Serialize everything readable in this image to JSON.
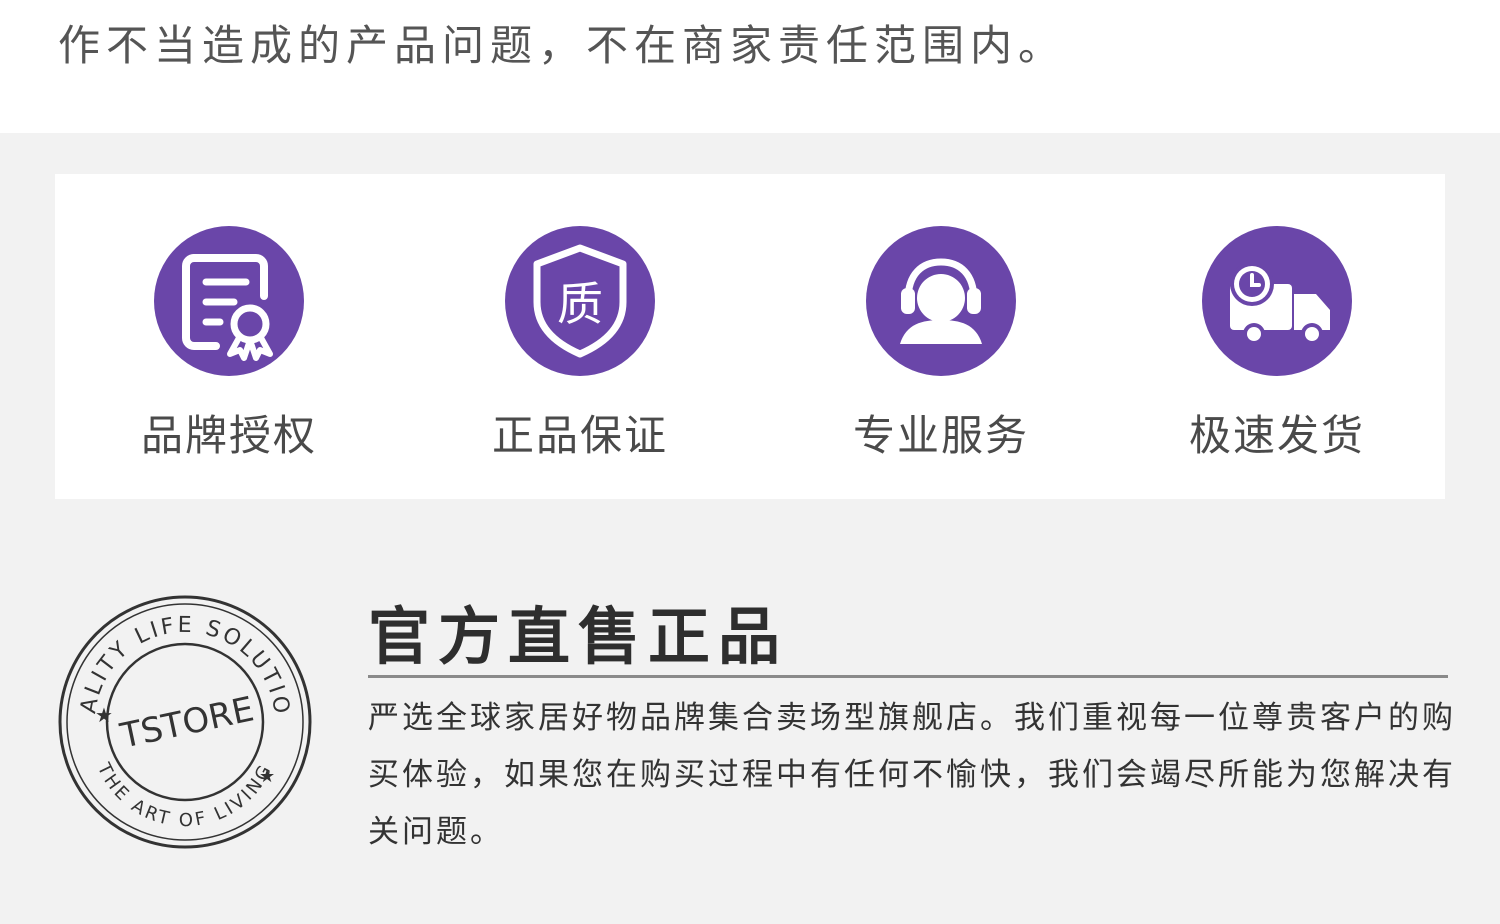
{
  "top_text": "作不当造成的产品问题，不在商家责任范围内。",
  "features": [
    {
      "label": "品牌授权",
      "icon": "certificate-icon"
    },
    {
      "label": "正品保证",
      "icon": "quality-shield-icon",
      "icon_glyph": "质"
    },
    {
      "label": "专业服务",
      "icon": "customer-service-icon"
    },
    {
      "label": "极速发货",
      "icon": "delivery-truck-icon"
    }
  ],
  "seal": {
    "outer_top": "QUALITY LIFE SOLUTIONS",
    "outer_bottom": "THE ART OF LIVING",
    "center": "TSTORE"
  },
  "info": {
    "title": "官方直售正品",
    "description": "严选全球家居好物品牌集合卖场型旗舰店。我们重视每一位尊贵客户的购买体验，如果您在购买过程中有任何不愉快，我们会竭尽所能为您解决有关问题。"
  },
  "colors": {
    "accent": "#6a46a9",
    "page_bg": "#f2f2f2",
    "card_bg": "#ffffff"
  }
}
